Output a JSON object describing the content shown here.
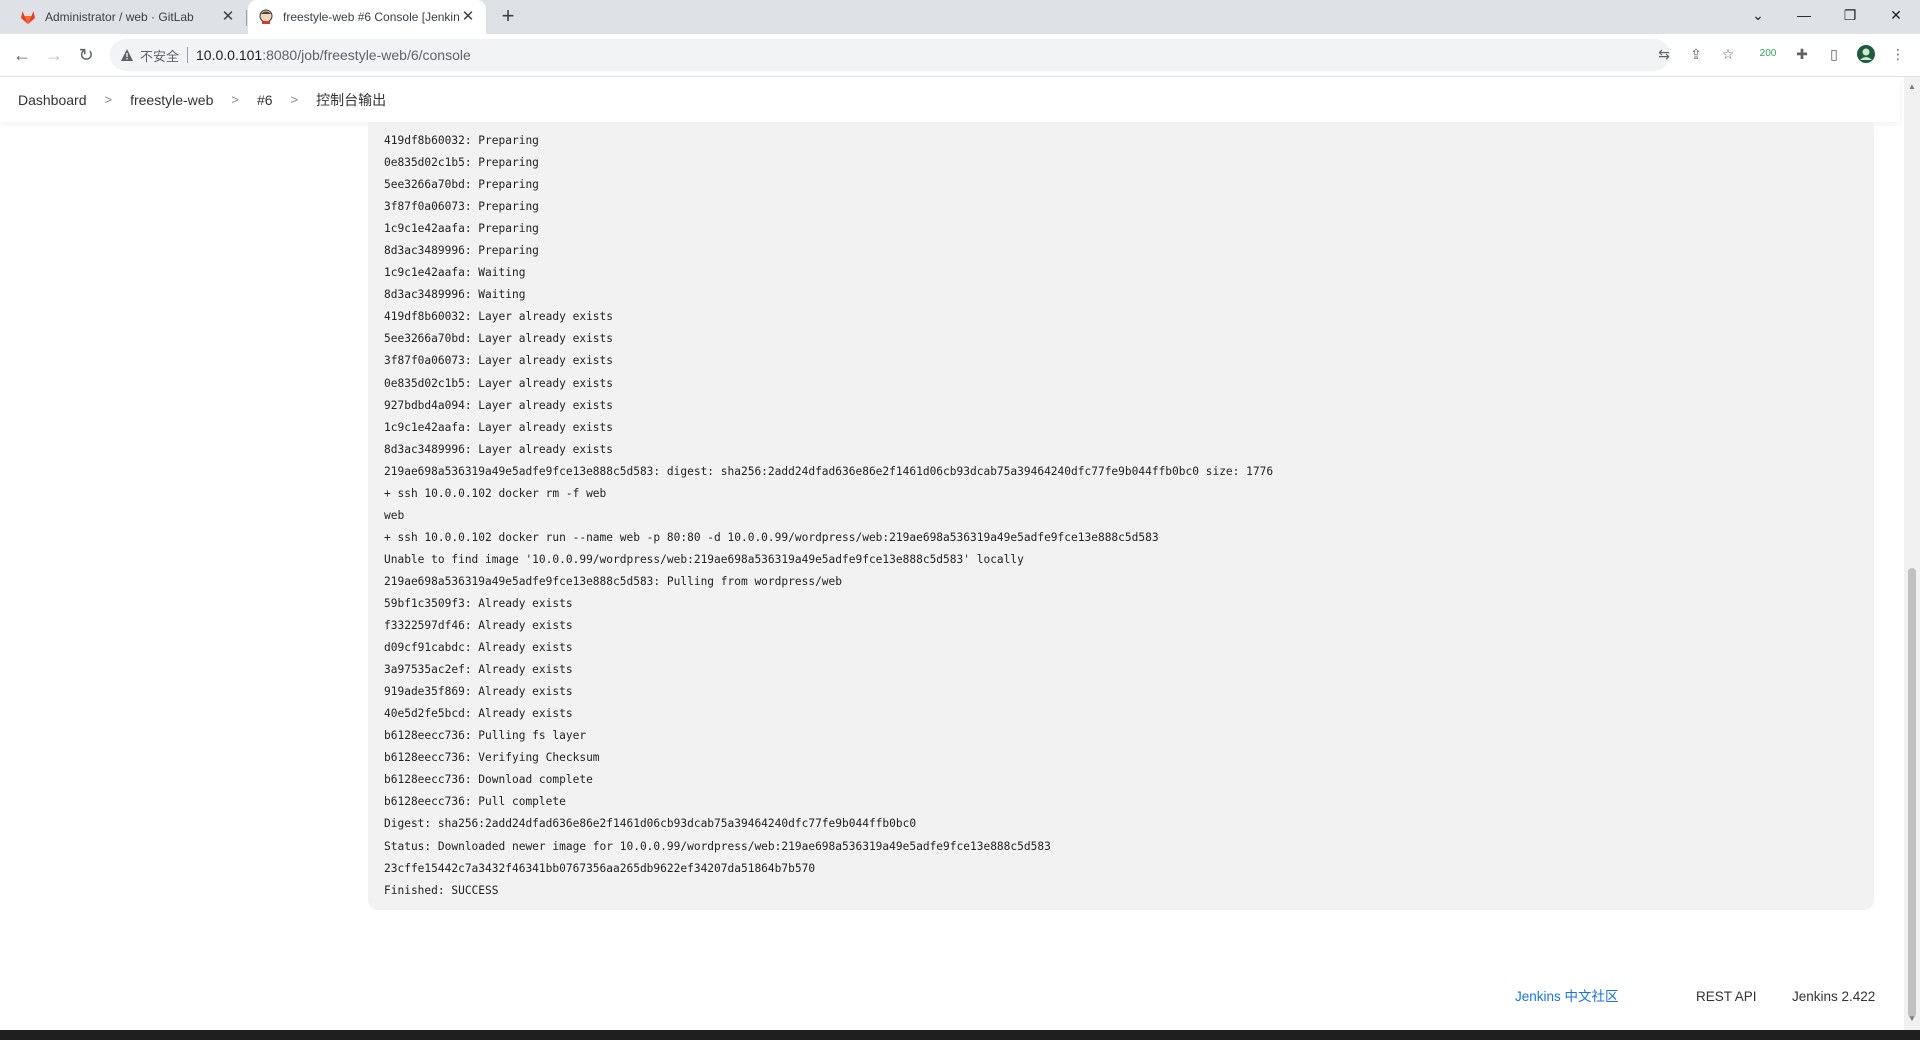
{
  "browser": {
    "tabs": [
      {
        "title": "Administrator / web · GitLab",
        "active": false,
        "favicon": "gitlab-icon"
      },
      {
        "title": "freestyle-web #6 Console [Jenkins]",
        "active": true,
        "favicon": "jenkins-icon"
      }
    ],
    "address": {
      "insecure_label": "不安全",
      "host": "10.0.0.101",
      "path": ":8080/job/freestyle-web/6/console"
    },
    "extension_badge": "200"
  },
  "breadcrumb": {
    "items": [
      "Dashboard",
      "freestyle-web",
      "#6",
      "控制台输出"
    ]
  },
  "console": {
    "lines": [
      "419df8b60032: Preparing",
      "0e835d02c1b5: Preparing",
      "5ee3266a70bd: Preparing",
      "3f87f0a06073: Preparing",
      "1c9c1e42aafa: Preparing",
      "8d3ac3489996: Preparing",
      "1c9c1e42aafa: Waiting",
      "8d3ac3489996: Waiting",
      "419df8b60032: Layer already exists",
      "5ee3266a70bd: Layer already exists",
      "3f87f0a06073: Layer already exists",
      "0e835d02c1b5: Layer already exists",
      "927bdbd4a094: Layer already exists",
      "1c9c1e42aafa: Layer already exists",
      "8d3ac3489996: Layer already exists",
      "219ae698a536319a49e5adfe9fce13e888c5d583: digest: sha256:2add24dfad636e86e2f1461d06cb93dcab75a39464240dfc77fe9b044ffb0bc0 size: 1776",
      "+ ssh 10.0.0.102 docker rm -f web",
      "web",
      "+ ssh 10.0.0.102 docker run --name web -p 80:80 -d 10.0.0.99/wordpress/web:219ae698a536319a49e5adfe9fce13e888c5d583",
      "Unable to find image '10.0.0.99/wordpress/web:219ae698a536319a49e5adfe9fce13e888c5d583' locally",
      "219ae698a536319a49e5adfe9fce13e888c5d583: Pulling from wordpress/web",
      "59bf1c3509f3: Already exists",
      "f3322597df46: Already exists",
      "d09cf91cabdc: Already exists",
      "3a97535ac2ef: Already exists",
      "919ade35f869: Already exists",
      "40e5d2fe5bcd: Already exists",
      "b6128eecc736: Pulling fs layer",
      "b6128eecc736: Verifying Checksum",
      "b6128eecc736: Download complete",
      "b6128eecc736: Pull complete",
      "Digest: sha256:2add24dfad636e86e2f1461d06cb93dcab75a39464240dfc77fe9b044ffb0bc0",
      "Status: Downloaded newer image for 10.0.0.99/wordpress/web:219ae698a536319a49e5adfe9fce13e888c5d583",
      "23cffe15442c7a3432f46341bb0767356aa265db9622ef34207da51864b7b570",
      "Finished: SUCCESS"
    ]
  },
  "footer": {
    "community_link": "Jenkins 中文社区",
    "rest_api": "REST API",
    "version": "Jenkins 2.422"
  },
  "colors": {
    "link": "#1a73e8",
    "console_bg": "#f2f2f2",
    "tabstrip_bg": "#dee1e6"
  }
}
